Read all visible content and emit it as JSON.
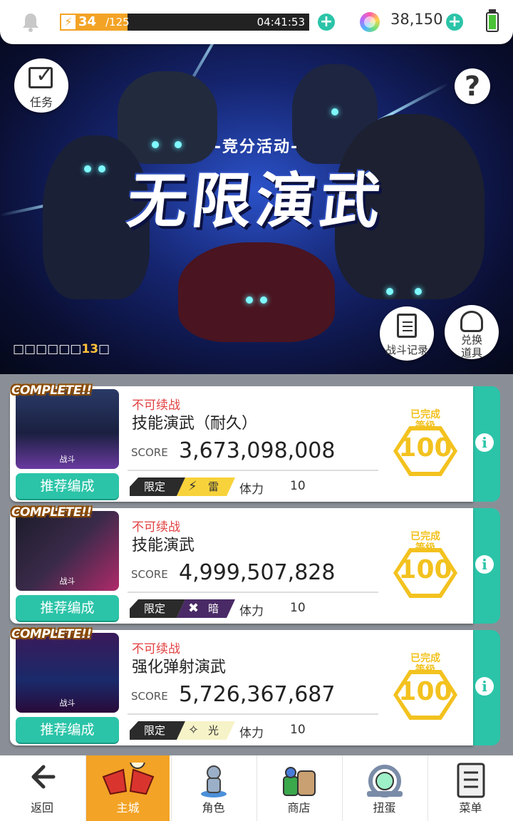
{
  "topbar": {
    "stamina_current": "34",
    "stamina_max": "/125",
    "stamina_fraction": 0.272,
    "timer": "04:41:53",
    "gems": "38,150",
    "accent": "#2bc4a8",
    "stamina_color": "#f3a326"
  },
  "banner": {
    "subtitle": "-竞分活动-",
    "title": "无限演武",
    "tasks_label": "任务",
    "help_label": "?",
    "log_label": "战斗记录",
    "exchange_label": "兑换\n道具",
    "period_prefix": "□□□□□□",
    "period_number": "13",
    "period_suffix": "□"
  },
  "cards": [
    {
      "complete": "COMPLETE!!",
      "thumb_label": "战斗",
      "recommend": "推荐编成",
      "status": "不可续战",
      "name": "技能演武（耐久）",
      "score_label": "SCORE",
      "score": "3,673,098,008",
      "limit_label": "限定",
      "element_icon": "⚡",
      "element": "雷",
      "element_bg": "#f7d23a",
      "element_fg": "#333",
      "stamina_label": "体力",
      "stamina": "10",
      "medal_label": "已完成\n等级",
      "medal_value": "100"
    },
    {
      "complete": "COMPLETE!!",
      "thumb_label": "战斗",
      "recommend": "推荐编成",
      "status": "不可续战",
      "name": "技能演武",
      "score_label": "SCORE",
      "score": "4,999,507,828",
      "limit_label": "限定",
      "element_icon": "✖",
      "element": "暗",
      "element_bg": "#4a2a66",
      "element_fg": "#fff",
      "stamina_label": "体力",
      "stamina": "10",
      "medal_label": "已完成\n等级",
      "medal_value": "100"
    },
    {
      "complete": "COMPLETE!!",
      "thumb_label": "战斗",
      "recommend": "推荐编成",
      "status": "不可续战",
      "name": "强化弹射演武",
      "score_label": "SCORE",
      "score": "5,726,367,687",
      "limit_label": "限定",
      "element_icon": "✧",
      "element": "光",
      "element_bg": "#f6f3c8",
      "element_fg": "#333",
      "stamina_label": "体力",
      "stamina": "10",
      "medal_label": "已完成\n等级",
      "medal_value": "100"
    }
  ],
  "nav": [
    {
      "label": "返回",
      "icon": "back-arrow-icon"
    },
    {
      "label": "主城",
      "icon": "castle-icon"
    },
    {
      "label": "角色",
      "icon": "character-icon"
    },
    {
      "label": "商店",
      "icon": "shop-icon"
    },
    {
      "label": "扭蛋",
      "icon": "gacha-icon"
    },
    {
      "label": "菜单",
      "icon": "menu-icon"
    }
  ]
}
